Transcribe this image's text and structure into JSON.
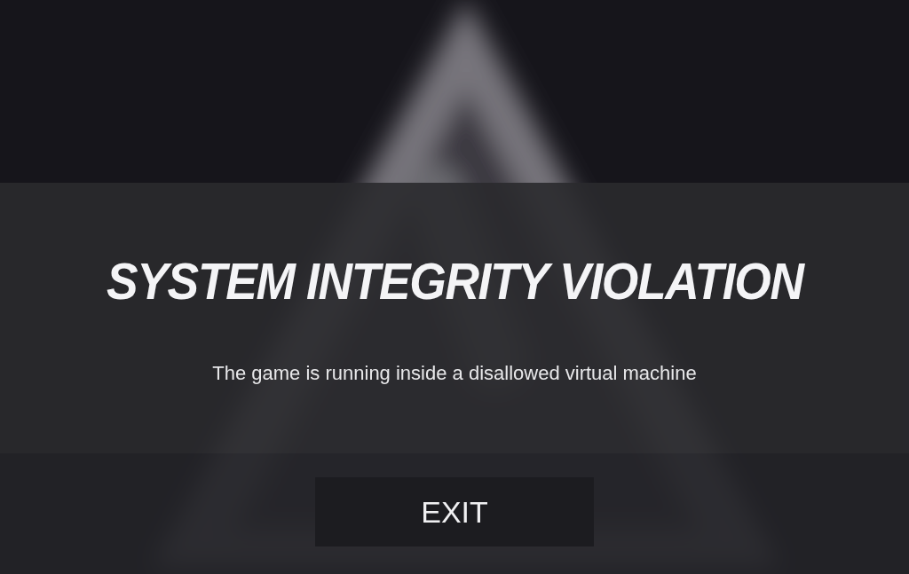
{
  "dialog": {
    "title": "SYSTEM INTEGRITY VIOLATION",
    "message": "The game is running inside a disallowed virtual machine"
  },
  "buttons": [
    {
      "label": "EXIT"
    }
  ]
}
